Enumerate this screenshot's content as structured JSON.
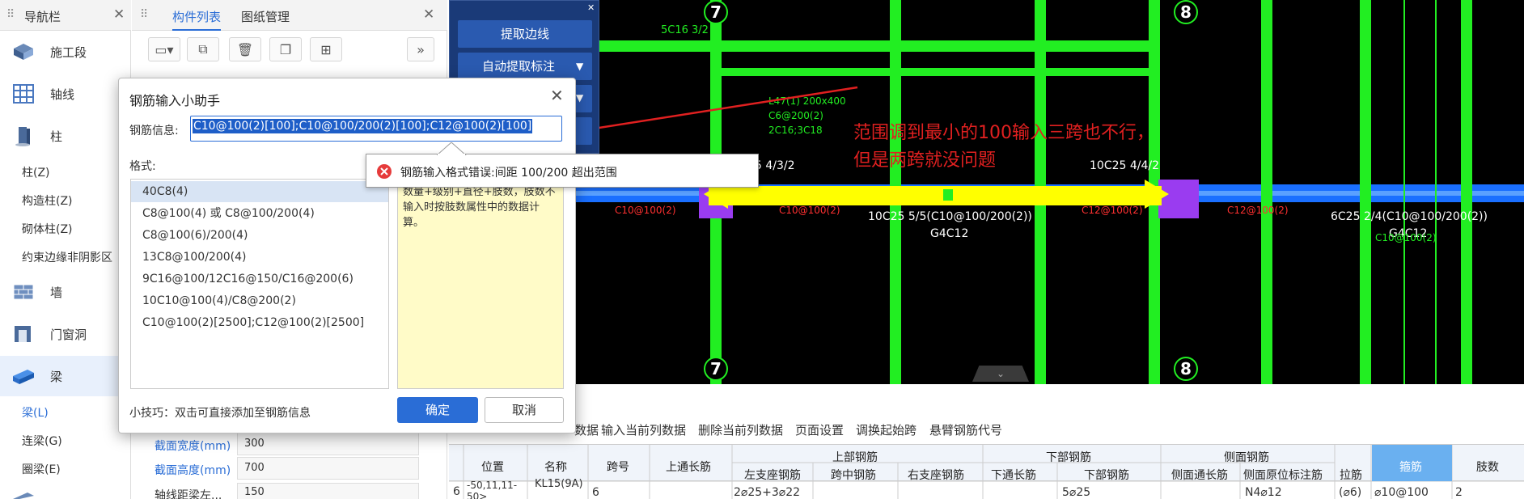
{
  "nav_panel": {
    "title": "导航栏",
    "items": [
      {
        "label": "施工段",
        "icon": "construction-section-icon"
      },
      {
        "label": "轴线",
        "icon": "grid-axis-icon"
      },
      {
        "label": "柱",
        "icon": "column-icon"
      },
      {
        "label": "墙",
        "icon": "wall-icon"
      },
      {
        "label": "门窗洞",
        "icon": "door-window-icon"
      },
      {
        "label": "梁",
        "icon": "beam-icon"
      }
    ],
    "column_sub": [
      "柱(Z)",
      "构造柱(Z)",
      "砌体柱(Z)",
      "约束边缘非阴影区"
    ],
    "beam_sub": [
      "梁(L)",
      "连梁(G)",
      "圈梁(E)"
    ]
  },
  "component_panel": {
    "tabs": [
      "构件列表",
      "图纸管理"
    ],
    "properties": [
      {
        "name": "截面宽度(mm)",
        "value": "300"
      },
      {
        "name": "截面高度(mm)",
        "value": "700"
      },
      {
        "name": "轴线距梁左...",
        "value": "150"
      }
    ]
  },
  "cad_panel": {
    "buttons": [
      "提取边线",
      "自动提取标注"
    ]
  },
  "dialog": {
    "title": "钢筋输入小助手",
    "info_label": "钢筋信息:",
    "info_value": "C10@100(2)[100];C10@100/200(2)[100];C12@100(2)[100]",
    "format_label": "格式:",
    "formats": [
      "40C8(4)",
      "C8@100(4) 或 C8@100/200(4)",
      "C8@100(6)/200(4)",
      "13C8@100/200(4)",
      "9C16@100/12C16@150/C16@200(6)",
      "10C10@100(4)/C8@200(2)",
      "C10@100(2)[2500];C12@100(2)[2500]"
    ],
    "description": "数量+级别+直径+肢数，肢数不输入时按肢数属性中的数据计算。",
    "tip": "小技巧：双击可直接添加至钢筋信息",
    "ok": "确定",
    "cancel": "取消"
  },
  "error_tooltip": "钢筋输入格式错误:间距 100/200 超出范围",
  "annotation": [
    "范围调到最小的100输入三跨也不行，",
    "但是两跨就没问题"
  ],
  "drawing": {
    "axes": [
      "7",
      "8"
    ],
    "texts": [
      "5C16 3/2",
      "L47(1) 200x400",
      "C6@200(2)",
      "2C16;3C18",
      "5 4/3/2",
      "10C25 4/4/2",
      "C10@100(2)",
      "C10@100(2)",
      "C12@100(2)",
      "C12@100(2)",
      "10C25 5/5(C10@100/200(2))",
      "G4C12",
      "6C25 2/4(C10@100/200(2))",
      "G4C12",
      "C10@100(2)"
    ]
  },
  "table": {
    "toolbar": [
      "数据",
      "输入当前列数据",
      "删除当前列数据",
      "页面设置",
      "调换起始跨",
      "悬臂钢筋代号"
    ],
    "headers": {
      "position": "位置",
      "name": "名称",
      "span": "跨号",
      "top_through": "上通长筋",
      "upper": "上部钢筋",
      "upper_sub": [
        "左支座钢筋",
        "跨中钢筋",
        "右支座钢筋"
      ],
      "lower": "下部钢筋",
      "lower_sub": [
        "下通长筋",
        "下部钢筋"
      ],
      "side": "侧面钢筋",
      "side_sub": [
        "侧面通长筋",
        "侧面原位标注筋"
      ],
      "tie": "拉筋",
      "stirrup": "箍筋",
      "legs": "肢数"
    },
    "row": {
      "index": "6",
      "position": "-50,11,11-50>",
      "name": "KL15(9A)",
      "span": "6",
      "left_support": "2⌀25+3⌀22",
      "lower_bar": "5⌀25",
      "side_pos": "N4⌀12",
      "tie": "(⌀6)",
      "stirrup": "⌀10@100",
      "legs": "2"
    }
  },
  "colors": {
    "accent": "#2a6dd6",
    "cad_green": "#22ee22",
    "cad_yellow": "#ffff00",
    "annotation_red": "#e02020"
  }
}
